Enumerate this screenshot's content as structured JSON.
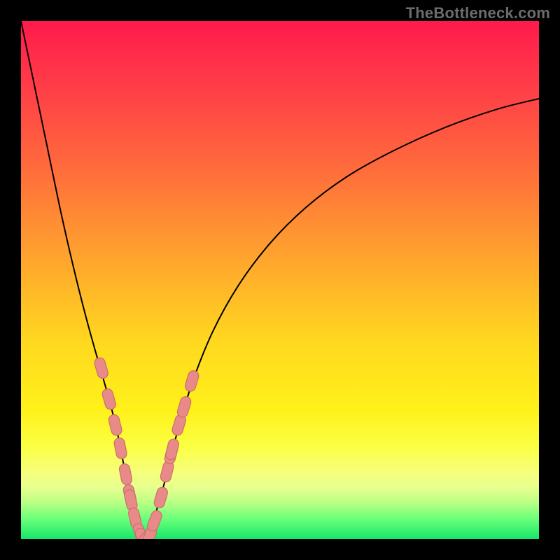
{
  "watermark": "TheBottleneck.com",
  "chart_data": {
    "type": "line",
    "title": "",
    "xlabel": "",
    "ylabel": "",
    "xlim": [
      0,
      100
    ],
    "ylim": [
      0,
      100
    ],
    "grid": false,
    "legend": false,
    "background_gradient": {
      "direction": "vertical",
      "stops": [
        {
          "pos": 0.0,
          "color": "#ff1a4b"
        },
        {
          "pos": 0.12,
          "color": "#ff3b48"
        },
        {
          "pos": 0.28,
          "color": "#ff6a3c"
        },
        {
          "pos": 0.45,
          "color": "#ffa22e"
        },
        {
          "pos": 0.62,
          "color": "#ffd81f"
        },
        {
          "pos": 0.75,
          "color": "#fff11a"
        },
        {
          "pos": 0.82,
          "color": "#fbff42"
        },
        {
          "pos": 0.87,
          "color": "#f6ff7a"
        },
        {
          "pos": 0.9,
          "color": "#e8ff8e"
        },
        {
          "pos": 0.93,
          "color": "#b9ff84"
        },
        {
          "pos": 0.96,
          "color": "#6dff7a"
        },
        {
          "pos": 1.0,
          "color": "#17e86b"
        }
      ]
    },
    "series": [
      {
        "name": "bottleneck-curve",
        "color": "#000000",
        "width": 2,
        "x": [
          0.0,
          2.5,
          5.0,
          7.5,
          10.0,
          12.5,
          15.0,
          17.0,
          18.5,
          19.7,
          20.7,
          21.6,
          22.3,
          23.0,
          23.6,
          24.5,
          26.0,
          28.0,
          30.0,
          33.0,
          37.0,
          42.0,
          48.0,
          55.0,
          63.0,
          72.0,
          82.0,
          92.0,
          100.0
        ],
        "y": [
          100.0,
          88.0,
          76.0,
          64.0,
          53.0,
          43.0,
          34.0,
          27.0,
          21.0,
          15.0,
          10.0,
          6.0,
          3.0,
          1.0,
          0.0,
          1.0,
          5.0,
          12.0,
          20.0,
          30.0,
          40.0,
          49.0,
          57.0,
          64.0,
          70.0,
          75.0,
          79.5,
          83.0,
          85.0
        ]
      },
      {
        "name": "marker-capsules",
        "type": "scatter",
        "color": "#e88a87",
        "stroke": "#cc6e6c",
        "shape": "capsule",
        "angle_follows_curve": true,
        "points": [
          {
            "x": 15.5,
            "y": 33.0
          },
          {
            "x": 17.0,
            "y": 27.0
          },
          {
            "x": 18.2,
            "y": 22.0
          },
          {
            "x": 19.2,
            "y": 17.5
          },
          {
            "x": 20.2,
            "y": 12.5
          },
          {
            "x": 21.0,
            "y": 8.5
          },
          {
            "x": 21.2,
            "y": 7.5
          },
          {
            "x": 22.0,
            "y": 4.0
          },
          {
            "x": 23.0,
            "y": 1.0
          },
          {
            "x": 23.6,
            "y": 0.2
          },
          {
            "x": 24.2,
            "y": 0.2
          },
          {
            "x": 24.8,
            "y": 0.5
          },
          {
            "x": 25.8,
            "y": 3.5
          },
          {
            "x": 27.0,
            "y": 8.0
          },
          {
            "x": 28.2,
            "y": 13.0
          },
          {
            "x": 29.0,
            "y": 16.5
          },
          {
            "x": 29.2,
            "y": 17.3
          },
          {
            "x": 30.5,
            "y": 22.0
          },
          {
            "x": 31.5,
            "y": 25.5
          },
          {
            "x": 33.0,
            "y": 30.5
          }
        ]
      }
    ]
  }
}
